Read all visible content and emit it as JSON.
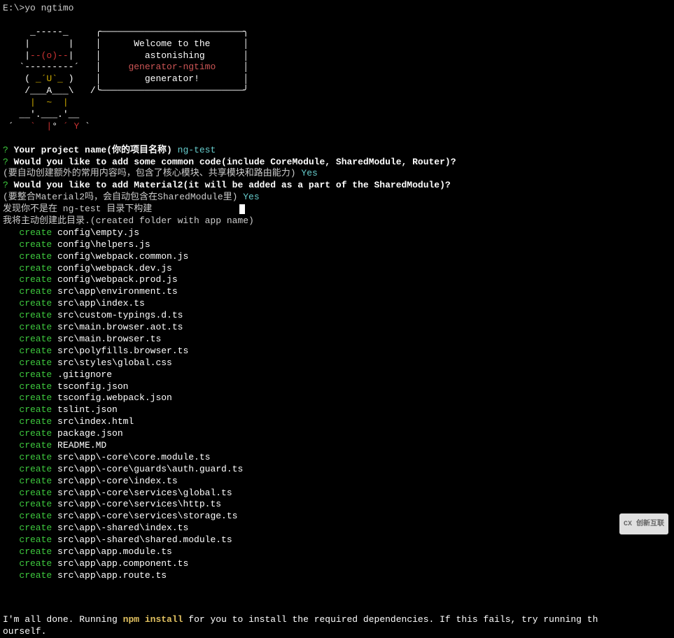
{
  "prompt": "E:\\>yo ngtimo",
  "ascii": {
    "l1": "     _-----_     ╭──────────────────────────╮",
    "l2_a": "    |       |    ",
    "l2_b": "│      Welcome to the      │",
    "l3_a": "    |",
    "l3_b": "--(o)--",
    "l3_c": "|    ",
    "l3_d": "│        astonishing       │",
    "l4_a": "   `---------´   ",
    "l4_b": "│     ",
    "l4_c": "generator-ngtimo",
    "l4_d": "     │",
    "l5_a": "    ( ",
    "l5_b": "_´U`_",
    "l5_c": " )    ",
    "l5_d": "│        generator!        │",
    "l6": "    /___A___\\   /╰──────────────────────────╯",
    "l7_a": "     ",
    "l7_b": "|  ~  |",
    "l8": "   __'.___.'__",
    "l9_a": " ´   ",
    "l9_b": "`  |",
    "l9_c": "° ",
    "l9_d": "´ Y",
    "l9_e": " `"
  },
  "q1": {
    "mark": "?",
    "text": " Your project name(你的项目名称) ",
    "answer": "ng-test"
  },
  "q2": {
    "mark": "?",
    "text": " Would you like to add some common code(include CoreModule, SharedModule, Router)?",
    "sub": "(要自动创建额外的常用内容吗，包含了核心模块、共享模块和路由能力) ",
    "answer": "Yes"
  },
  "q3": {
    "mark": "?",
    "text": " Would you like to add Material2(it will be added as a part of the SharedModule)?",
    "sub": "(要整合Material2吗，会自动包含在SharedModule里) ",
    "answer": "Yes"
  },
  "notice1": "发现你不是在 ng-test 目录下构建",
  "notice2": "我将主动创建此目录.(created folder with app name)",
  "create_label": "create",
  "files": [
    "config\\empty.js",
    "config\\helpers.js",
    "config\\webpack.common.js",
    "config\\webpack.dev.js",
    "config\\webpack.prod.js",
    "src\\app\\environment.ts",
    "src\\app\\index.ts",
    "src\\custom-typings.d.ts",
    "src\\main.browser.aot.ts",
    "src\\main.browser.ts",
    "src\\polyfills.browser.ts",
    "src\\styles\\global.css",
    ".gitignore",
    "tsconfig.json",
    "tsconfig.webpack.json",
    "tslint.json",
    "src\\index.html",
    "package.json",
    "README.MD",
    "src\\app\\-core\\core.module.ts",
    "src\\app\\-core\\guards\\auth.guard.ts",
    "src\\app\\-core\\index.ts",
    "src\\app\\-core\\services\\global.ts",
    "src\\app\\-core\\services\\http.ts",
    "src\\app\\-core\\services\\storage.ts",
    "src\\app\\-shared\\index.ts",
    "src\\app\\-shared\\shared.module.ts",
    "src\\app\\app.module.ts",
    "src\\app\\app.component.ts",
    "src\\app\\app.route.ts"
  ],
  "final": {
    "pre": "I'm all done. Running ",
    "npm": "npm install",
    "post": " for you to install the required dependencies. If this fails, try running th",
    "line2": "ourself."
  },
  "logo": "CX 创新互联"
}
